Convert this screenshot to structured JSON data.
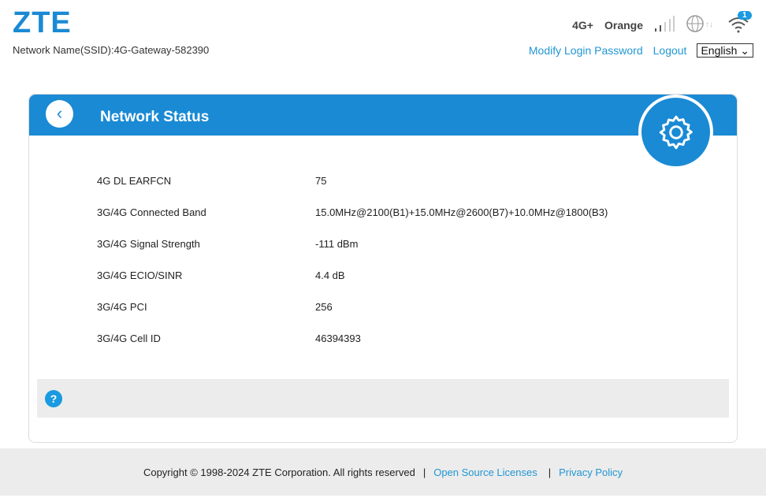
{
  "header": {
    "logo": "ZTE",
    "ssid": "Network Name(SSID):4G-Gateway-582390",
    "network_type": "4G+",
    "operator": "Orange",
    "wifi_badge": "1",
    "modify_password": "Modify Login Password",
    "logout": "Logout",
    "language": "English"
  },
  "card": {
    "title": "Network Status",
    "rows": [
      {
        "label": "4G DL EARFCN",
        "value": "75"
      },
      {
        "label": "3G/4G Connected Band",
        "value": "15.0MHz@2100(B1)+15.0MHz@2600(B7)+10.0MHz@1800(B3)"
      },
      {
        "label": "3G/4G Signal Strength",
        "value": "-111 dBm"
      },
      {
        "label": "3G/4G ECIO/SINR",
        "value": "4.4 dB"
      },
      {
        "label": "3G/4G PCI",
        "value": "256"
      },
      {
        "label": "3G/4G Cell ID",
        "value": "46394393"
      }
    ],
    "help": "?"
  },
  "footer": {
    "copyright": "Copyright © 1998-2024 ZTE Corporation. All rights reserved",
    "sep": "|",
    "open_source": "Open Source Licenses",
    "privacy": "Privacy Policy"
  },
  "colors": {
    "accent": "#1a8ad4"
  }
}
